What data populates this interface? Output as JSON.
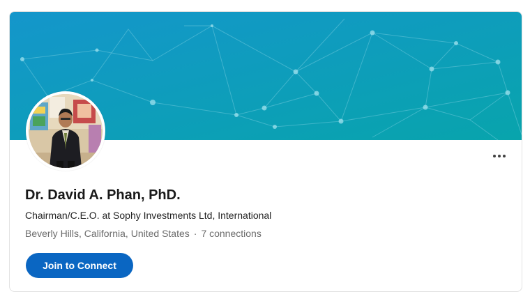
{
  "profile": {
    "name": "Dr. David A. Phan, PhD.",
    "headline": "Chairman/C.E.O. at Sophy Investments Ltd, International",
    "location": "Beverly Hills, California, United States",
    "separator": "·",
    "connections": "7 connections"
  },
  "actions": {
    "connect_label": "Join to Connect",
    "more_icon": "more-horizontal-icon"
  },
  "colors": {
    "cover_start": "#1596c9",
    "cover_end": "#0aa2ae",
    "button": "#0a66c2"
  }
}
